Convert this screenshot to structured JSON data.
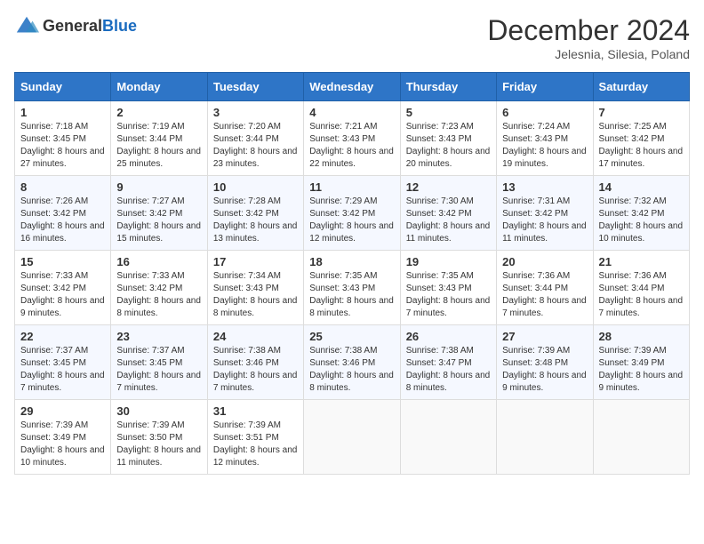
{
  "header": {
    "logo_general": "General",
    "logo_blue": "Blue",
    "month": "December 2024",
    "location": "Jelesnia, Silesia, Poland"
  },
  "weekdays": [
    "Sunday",
    "Monday",
    "Tuesday",
    "Wednesday",
    "Thursday",
    "Friday",
    "Saturday"
  ],
  "weeks": [
    [
      {
        "day": "1",
        "sunrise": "7:18 AM",
        "sunset": "3:45 PM",
        "daylight": "8 hours and 27 minutes."
      },
      {
        "day": "2",
        "sunrise": "7:19 AM",
        "sunset": "3:44 PM",
        "daylight": "8 hours and 25 minutes."
      },
      {
        "day": "3",
        "sunrise": "7:20 AM",
        "sunset": "3:44 PM",
        "daylight": "8 hours and 23 minutes."
      },
      {
        "day": "4",
        "sunrise": "7:21 AM",
        "sunset": "3:43 PM",
        "daylight": "8 hours and 22 minutes."
      },
      {
        "day": "5",
        "sunrise": "7:23 AM",
        "sunset": "3:43 PM",
        "daylight": "8 hours and 20 minutes."
      },
      {
        "day": "6",
        "sunrise": "7:24 AM",
        "sunset": "3:43 PM",
        "daylight": "8 hours and 19 minutes."
      },
      {
        "day": "7",
        "sunrise": "7:25 AM",
        "sunset": "3:42 PM",
        "daylight": "8 hours and 17 minutes."
      }
    ],
    [
      {
        "day": "8",
        "sunrise": "7:26 AM",
        "sunset": "3:42 PM",
        "daylight": "8 hours and 16 minutes."
      },
      {
        "day": "9",
        "sunrise": "7:27 AM",
        "sunset": "3:42 PM",
        "daylight": "8 hours and 15 minutes."
      },
      {
        "day": "10",
        "sunrise": "7:28 AM",
        "sunset": "3:42 PM",
        "daylight": "8 hours and 13 minutes."
      },
      {
        "day": "11",
        "sunrise": "7:29 AM",
        "sunset": "3:42 PM",
        "daylight": "8 hours and 12 minutes."
      },
      {
        "day": "12",
        "sunrise": "7:30 AM",
        "sunset": "3:42 PM",
        "daylight": "8 hours and 11 minutes."
      },
      {
        "day": "13",
        "sunrise": "7:31 AM",
        "sunset": "3:42 PM",
        "daylight": "8 hours and 11 minutes."
      },
      {
        "day": "14",
        "sunrise": "7:32 AM",
        "sunset": "3:42 PM",
        "daylight": "8 hours and 10 minutes."
      }
    ],
    [
      {
        "day": "15",
        "sunrise": "7:33 AM",
        "sunset": "3:42 PM",
        "daylight": "8 hours and 9 minutes."
      },
      {
        "day": "16",
        "sunrise": "7:33 AM",
        "sunset": "3:42 PM",
        "daylight": "8 hours and 8 minutes."
      },
      {
        "day": "17",
        "sunrise": "7:34 AM",
        "sunset": "3:43 PM",
        "daylight": "8 hours and 8 minutes."
      },
      {
        "day": "18",
        "sunrise": "7:35 AM",
        "sunset": "3:43 PM",
        "daylight": "8 hours and 8 minutes."
      },
      {
        "day": "19",
        "sunrise": "7:35 AM",
        "sunset": "3:43 PM",
        "daylight": "8 hours and 7 minutes."
      },
      {
        "day": "20",
        "sunrise": "7:36 AM",
        "sunset": "3:44 PM",
        "daylight": "8 hours and 7 minutes."
      },
      {
        "day": "21",
        "sunrise": "7:36 AM",
        "sunset": "3:44 PM",
        "daylight": "8 hours and 7 minutes."
      }
    ],
    [
      {
        "day": "22",
        "sunrise": "7:37 AM",
        "sunset": "3:45 PM",
        "daylight": "8 hours and 7 minutes."
      },
      {
        "day": "23",
        "sunrise": "7:37 AM",
        "sunset": "3:45 PM",
        "daylight": "8 hours and 7 minutes."
      },
      {
        "day": "24",
        "sunrise": "7:38 AM",
        "sunset": "3:46 PM",
        "daylight": "8 hours and 7 minutes."
      },
      {
        "day": "25",
        "sunrise": "7:38 AM",
        "sunset": "3:46 PM",
        "daylight": "8 hours and 8 minutes."
      },
      {
        "day": "26",
        "sunrise": "7:38 AM",
        "sunset": "3:47 PM",
        "daylight": "8 hours and 8 minutes."
      },
      {
        "day": "27",
        "sunrise": "7:39 AM",
        "sunset": "3:48 PM",
        "daylight": "8 hours and 9 minutes."
      },
      {
        "day": "28",
        "sunrise": "7:39 AM",
        "sunset": "3:49 PM",
        "daylight": "8 hours and 9 minutes."
      }
    ],
    [
      {
        "day": "29",
        "sunrise": "7:39 AM",
        "sunset": "3:49 PM",
        "daylight": "8 hours and 10 minutes."
      },
      {
        "day": "30",
        "sunrise": "7:39 AM",
        "sunset": "3:50 PM",
        "daylight": "8 hours and 11 minutes."
      },
      {
        "day": "31",
        "sunrise": "7:39 AM",
        "sunset": "3:51 PM",
        "daylight": "8 hours and 12 minutes."
      },
      null,
      null,
      null,
      null
    ]
  ]
}
